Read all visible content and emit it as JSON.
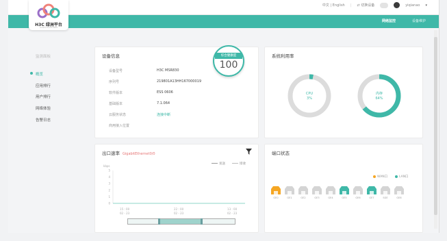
{
  "topbar": {
    "lang": "中文 | English",
    "switch_device": "⇄ 切换设备",
    "user": "yiqianao"
  },
  "tabs": [
    {
      "label": "网络监控",
      "active": true
    },
    {
      "label": "设备维护",
      "active": false
    }
  ],
  "logo": {
    "name": "H3C 绿洲平台",
    "sub": "OASIS PLATFORM"
  },
  "sidebar": {
    "title": "监测面板",
    "items": [
      {
        "label": "概览",
        "active": true
      },
      {
        "label": "应用排行",
        "active": false
      },
      {
        "label": "用户排行",
        "active": false
      },
      {
        "label": "网络体验",
        "active": false
      },
      {
        "label": "告警日志",
        "active": false
      }
    ]
  },
  "device_info": {
    "title": "设备信息",
    "rows": [
      {
        "label": "设备型号",
        "value": "H3C MSR830"
      },
      {
        "label": "序列号",
        "value": "219801A13HH167000019"
      },
      {
        "label": "软件版本",
        "value": "ESS 0606"
      },
      {
        "label": "基础版本",
        "value": "7.1.064"
      },
      {
        "label": "云服务状态",
        "value": "连接中断"
      },
      {
        "label": "商用接入位置",
        "value": ""
      }
    ],
    "score_label": "综合健康度",
    "score": "100"
  },
  "system_usage": {
    "title": "系统利用率",
    "cpu_label": "CPU",
    "cpu_value": "3%",
    "cpu_percent": 3,
    "mem_label": "内存",
    "mem_value": "64%",
    "mem_percent": 64
  },
  "outbound_rate": {
    "title": "出口速率",
    "interface": "GigabitEthernet0/0",
    "legend_tx": "发送",
    "legend_rx": "接收",
    "y_unit": "kbps",
    "y_ticks": [
      "5",
      "4",
      "3",
      "2",
      "1",
      "0"
    ],
    "x_ticks": [
      {
        "t1": "15 : 00",
        "t2": "02 - 23"
      },
      {
        "t1": "22 : 00",
        "t2": "02 - 23"
      },
      {
        "t1": "13 : 00",
        "t2": "02 - 23"
      }
    ],
    "chart_data": {
      "type": "line",
      "x": [
        "15:00",
        "22:00",
        "13:00"
      ],
      "series": [
        {
          "name": "发送",
          "values": [
            0,
            0,
            0
          ]
        },
        {
          "name": "接收",
          "values": [
            0,
            0,
            0
          ]
        }
      ],
      "ylabel": "kbps",
      "ylim": [
        0,
        5
      ]
    }
  },
  "port_status": {
    "title": "端口状态",
    "legend_wan": "WAN口",
    "legend_lan": "LAN口",
    "wan_color": "#f5a623",
    "lan_color": "#3fb8a8",
    "ports": [
      {
        "label": "GE0",
        "state": "wan"
      },
      {
        "label": "GE1",
        "state": "off"
      },
      {
        "label": "GE2",
        "state": "off"
      },
      {
        "label": "GE3",
        "state": "off"
      },
      {
        "label": "GE4",
        "state": "off"
      },
      {
        "label": "GE5",
        "state": "lan"
      },
      {
        "label": "GE6",
        "state": "off"
      },
      {
        "label": "GE7",
        "state": "lan"
      },
      {
        "label": "SGE",
        "state": "off"
      },
      {
        "label": "GE8",
        "state": "off"
      }
    ]
  },
  "colors": {
    "accent": "#3fb8a8",
    "warn": "#e57373"
  }
}
